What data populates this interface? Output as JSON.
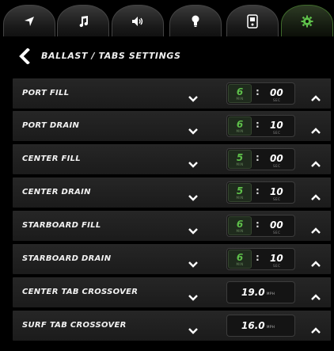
{
  "tabs": [
    {
      "icon": "navigation-arrow-icon",
      "active": false
    },
    {
      "icon": "music-note-icon",
      "active": false
    },
    {
      "icon": "speaker-icon",
      "active": false
    },
    {
      "icon": "light-bulb-icon",
      "active": false
    },
    {
      "icon": "remote-icon",
      "active": false
    },
    {
      "icon": "gear-icon",
      "active": true
    }
  ],
  "header": {
    "title": "BALLAST / TABS SETTINGS"
  },
  "rows": [
    {
      "label": "PORT FILL",
      "minutes": "6",
      "seconds": "00",
      "min_unit": "MIN",
      "sec_unit": "SEC"
    },
    {
      "label": "PORT DRAIN",
      "minutes": "6",
      "seconds": "10",
      "min_unit": "MIN",
      "sec_unit": "SEC"
    },
    {
      "label": "CENTER FILL",
      "minutes": "5",
      "seconds": "00",
      "min_unit": "MIN",
      "sec_unit": "SEC"
    },
    {
      "label": "CENTER DRAIN",
      "minutes": "5",
      "seconds": "10",
      "min_unit": "MIN",
      "sec_unit": "SEC"
    },
    {
      "label": "STARBOARD FILL",
      "minutes": "6",
      "seconds": "00",
      "min_unit": "MIN",
      "sec_unit": "SEC"
    },
    {
      "label": "STARBOARD DRAIN",
      "minutes": "6",
      "seconds": "10",
      "min_unit": "MIN",
      "sec_unit": "SEC"
    }
  ],
  "speed_rows": [
    {
      "label": "CENTER TAB CROSSOVER",
      "value": "19.0",
      "unit": "MPH"
    },
    {
      "label": "SURF TAB CROSSOVER",
      "value": "16.0",
      "unit": "MPH"
    }
  ],
  "colors": {
    "accent_green": "#5ec04a",
    "background": "#000000",
    "row_background": "#222222"
  }
}
